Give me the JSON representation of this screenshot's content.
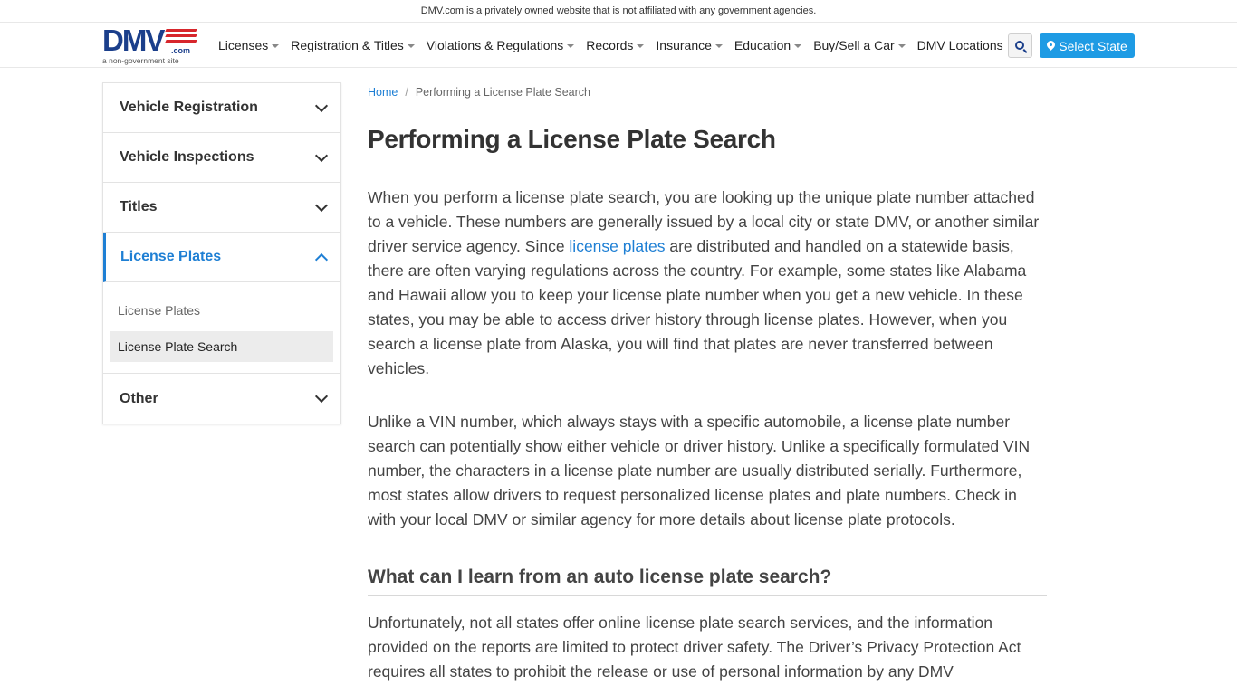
{
  "disclaimer": "DMV.com is a privately owned website that is not affiliated with any government agencies.",
  "logo": {
    "main": "DMV",
    "com": ".com",
    "sub": "a non-government site",
    "brand_color": "#1b3f8b",
    "accent_color": "#d7262c"
  },
  "nav": {
    "items": [
      {
        "label": "Licenses",
        "dropdown": true
      },
      {
        "label": "Registration & Titles",
        "dropdown": true
      },
      {
        "label": "Violations & Regulations",
        "dropdown": true
      },
      {
        "label": "Records",
        "dropdown": true
      },
      {
        "label": "Insurance",
        "dropdown": true
      },
      {
        "label": "Education",
        "dropdown": true
      },
      {
        "label": "Buy/Sell a Car",
        "dropdown": true
      },
      {
        "label": "DMV Locations",
        "dropdown": false
      }
    ],
    "search_icon": "search-icon",
    "select_state": "Select State",
    "select_state_color": "#1e9be4"
  },
  "sidebar": {
    "sections": [
      {
        "label": "Vehicle Registration",
        "expanded": false
      },
      {
        "label": "Vehicle Inspections",
        "expanded": false
      },
      {
        "label": "Titles",
        "expanded": false
      },
      {
        "label": "License Plates",
        "expanded": true
      },
      {
        "label": "Other",
        "expanded": false
      }
    ],
    "sub_items": [
      {
        "label": "License Plates"
      },
      {
        "label": "License Plate Search"
      }
    ]
  },
  "breadcrumb": {
    "home": "Home",
    "current": "Performing a License Plate Search"
  },
  "article": {
    "title": "Performing a License Plate Search",
    "p1_before": "When you perform a license plate search, you are looking up the unique plate number attached to a vehicle. These numbers are generally issued by a local city or state DMV, or another similar driver service agency. Since ",
    "p1_link": "license plates",
    "p1_after": " are distributed and handled on a statewide basis, there are often varying regulations across the country. For example, some states like Alabama and Hawaii allow you to keep your license plate number when you get a new vehicle. In these states, you may be able to access driver history through license plates. However, when you search a license plate from Alaska, you will find that plates are never transferred between vehicles.",
    "p2": "Unlike a VIN number, which always stays with a specific automobile, a license plate number search can potentially show either vehicle or driver history. Unlike a specifically formulated VIN number, the characters in a license plate number are usually distributed serially. Furthermore, most states allow drivers to request personalized license plates and plate numbers. Check in with your local DMV or similar agency for more details about license plate protocols.",
    "h2": "What can I learn from an auto license plate search?",
    "p3": "Unfortunately, not all states offer online license plate search services, and the information provided on the reports are limited to protect driver safety. The Driver’s Privacy Protection Act requires all states to prohibit the release or use of personal information by any DMV"
  }
}
